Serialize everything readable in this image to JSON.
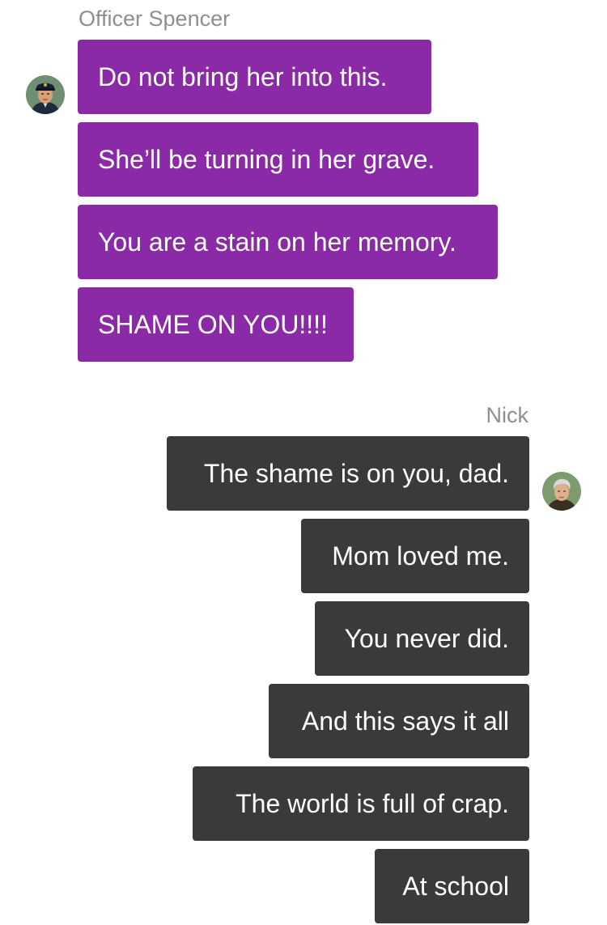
{
  "incoming": {
    "sender": "Officer Spencer",
    "avatar_icon": "police-officer-avatar",
    "color": "#8b2aa6",
    "messages": [
      "Do not bring her into this.",
      "She’ll be turning in her grave.",
      "You are a stain on her memory.",
      "SHAME ON YOU!!!!"
    ]
  },
  "outgoing": {
    "sender": "Nick",
    "avatar_icon": "gray-haired-man-avatar",
    "color": "#3a3a3c",
    "messages": [
      "The shame is on you, dad.",
      "Mom loved me.",
      "You never did.",
      "And this says it all",
      "The world is full of crap.",
      "At school"
    ]
  }
}
